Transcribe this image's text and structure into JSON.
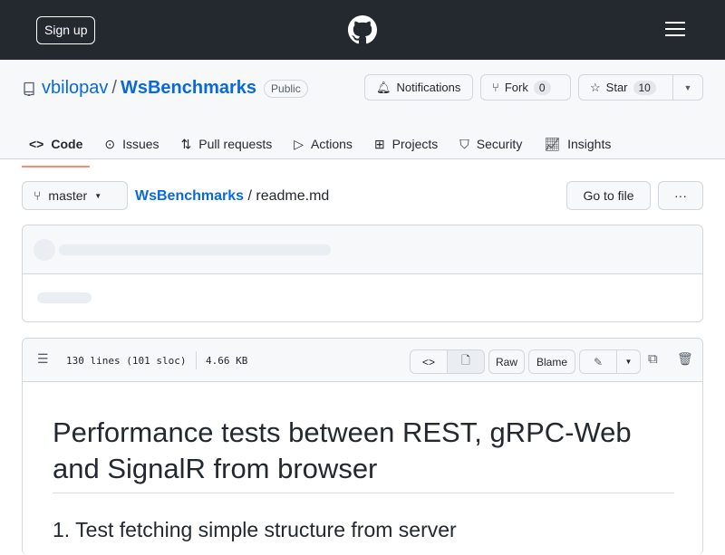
{
  "header": {
    "signup": "Sign up"
  },
  "repo": {
    "owner": "vbilopav",
    "sep": "/",
    "name": "WsBenchmarks",
    "visibility": "Public",
    "notifications": "Notifications",
    "fork": "Fork",
    "fork_count": "0",
    "star": "Star",
    "star_count": "10"
  },
  "tabs": [
    {
      "label": "Code"
    },
    {
      "label": "Issues"
    },
    {
      "label": "Pull requests"
    },
    {
      "label": "Actions"
    },
    {
      "label": "Projects"
    },
    {
      "label": "Security"
    },
    {
      "label": "Insights"
    }
  ],
  "file": {
    "branch": "master",
    "repo_link": "WsBenchmarks",
    "sep": "/",
    "filename": "readme.md",
    "goto": "Go to file",
    "more": "···",
    "lines": "130 lines (101 sloc)",
    "size": "4.66 KB",
    "raw": "Raw",
    "blame": "Blame"
  },
  "content": {
    "h1": "Performance tests between REST, gRPC-Web and SignalR from browser",
    "h2": "1. Test fetching simple structure from server"
  }
}
